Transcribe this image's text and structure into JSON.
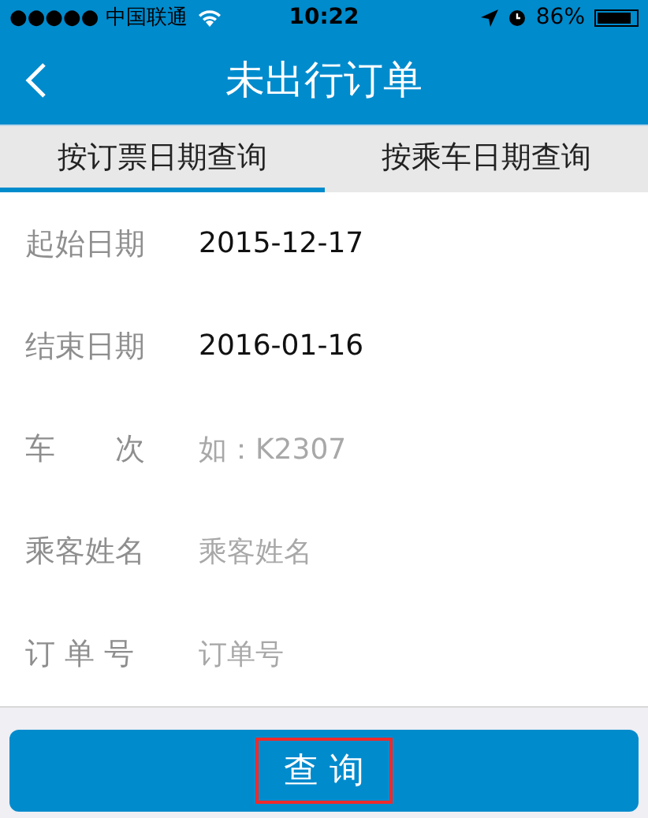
{
  "status_bar": {
    "carrier": "●●●●● 中国联通",
    "time": "10:22",
    "battery_text": "86%"
  },
  "nav": {
    "title": "未出行订单"
  },
  "tabs": [
    {
      "label": "按订票日期查询",
      "selected": true
    },
    {
      "label": "按乘车日期查询",
      "selected": false
    }
  ],
  "fields": [
    {
      "label": "起始日期",
      "value": "2015-12-17"
    },
    {
      "label": "结束日期",
      "value": "2016-01-16"
    },
    {
      "label": "车　　次",
      "placeholder": "如：K2307"
    },
    {
      "label": "乘客姓名",
      "placeholder": "乘客姓名"
    },
    {
      "label": "订 单 号",
      "placeholder": "订单号"
    }
  ],
  "button": {
    "label": "查 询",
    "highlighted": true
  }
}
